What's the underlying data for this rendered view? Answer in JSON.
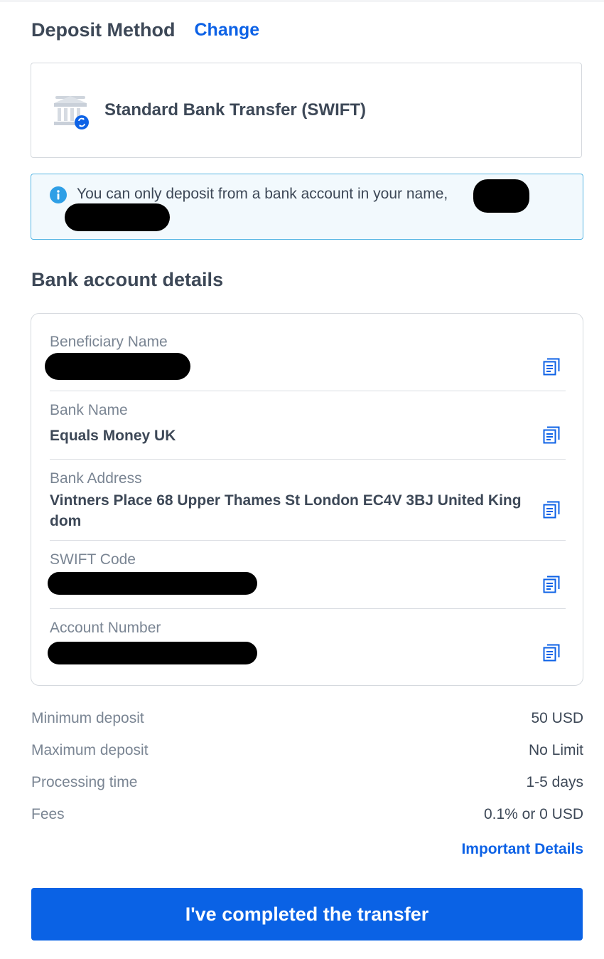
{
  "deposit_method": {
    "title": "Deposit Method",
    "change_label": "Change",
    "method_name": "Standard Bank Transfer (SWIFT)",
    "method_icon": "bank-transfer-icon"
  },
  "notice": {
    "icon": "info-icon",
    "text": "You can only deposit from a bank account in your name,"
  },
  "bank_details": {
    "title": "Bank account details",
    "rows": [
      {
        "label": "Beneficiary Name",
        "value": ""
      },
      {
        "label": "Bank Name",
        "value": "Equals Money UK"
      },
      {
        "label": "Bank Address",
        "value": "Vintners Place 68 Upper Thames St London EC4V 3BJ United King dom"
      },
      {
        "label": "SWIFT Code",
        "value": ""
      },
      {
        "label": "Account Number",
        "value": ""
      }
    ],
    "copy_icon": "copy-icon"
  },
  "limits": {
    "min_label": "Minimum deposit",
    "min_value": "50 USD",
    "max_label": "Maximum deposit",
    "max_value": "No Limit",
    "time_label": "Processing time",
    "time_value": "1-5 days",
    "fees_label": "Fees",
    "fees_value": "0.1% or 0 USD"
  },
  "important_details_label": "Important Details",
  "cta_label": "I've completed the transfer",
  "colors": {
    "accent": "#0d62e6",
    "notice_border": "#57b6e4",
    "notice_bg": "#f2f9fd",
    "text_primary": "#3d4857",
    "text_muted": "#7a8593"
  }
}
